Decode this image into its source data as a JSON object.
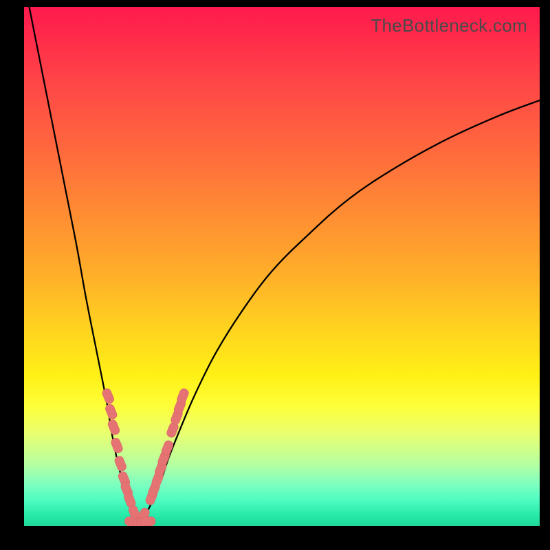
{
  "watermark": "TheBottleneck.com",
  "colors": {
    "frame": "#000000",
    "curve": "#000000",
    "marker": "#e57373",
    "gradient_top": "#ff1a4d",
    "gradient_bottom": "#1fd99b"
  },
  "chart_data": {
    "type": "line",
    "title": "",
    "xlabel": "",
    "ylabel": "",
    "xlim": [
      0,
      100
    ],
    "ylim": [
      0,
      100
    ],
    "min_x": 22,
    "series": [
      {
        "name": "left-branch",
        "x": [
          1,
          4,
          7,
          10,
          12,
          14,
          16,
          17,
          18,
          19,
          20,
          21,
          22,
          22.5
        ],
        "y": [
          100,
          85,
          70,
          55,
          44,
          34,
          24,
          18,
          13,
          9,
          6,
          3.5,
          1.5,
          0.7
        ]
      },
      {
        "name": "right-branch",
        "x": [
          22.5,
          23,
          24,
          25,
          26,
          27,
          28,
          30,
          33,
          37,
          42,
          48,
          55,
          63,
          72,
          82,
          92,
          100
        ],
        "y": [
          0.7,
          1.3,
          3,
          5,
          7.5,
          10,
          13,
          18,
          25,
          33,
          41,
          49,
          56,
          63,
          69,
          74.5,
          79,
          82
        ]
      }
    ],
    "markers_left": {
      "x": [
        16.3,
        16.9,
        17.4,
        18.0,
        18.7,
        19.4,
        19.9,
        20.5,
        21.4
      ],
      "y": [
        25,
        22,
        19,
        15.5,
        12,
        9,
        7,
        5,
        2.5
      ]
    },
    "markers_right": {
      "x": [
        23.2,
        24.7,
        25.2,
        25.9,
        26.5,
        27.1,
        27.8,
        28.8,
        29.6,
        30.2,
        30.8
      ],
      "y": [
        2,
        5.5,
        7,
        9,
        11,
        13,
        15,
        18.5,
        21,
        23,
        25
      ]
    },
    "markers_bottom": {
      "x": [
        21.0,
        21.8,
        22.5,
        23.2,
        24.0
      ],
      "y": [
        0.9,
        0.6,
        0.5,
        0.6,
        0.9
      ]
    }
  }
}
